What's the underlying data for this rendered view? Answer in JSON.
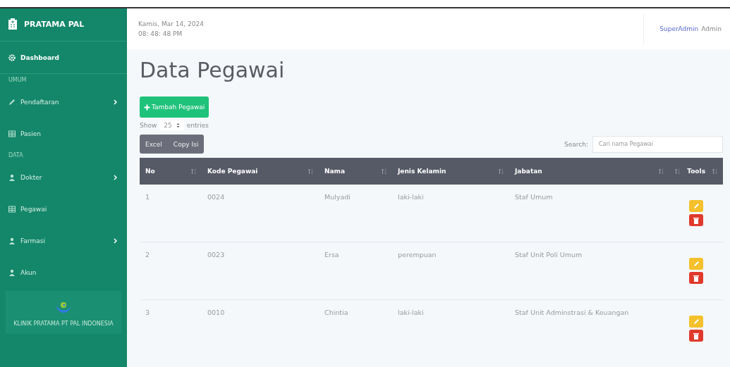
{
  "brand": {
    "title": "PRATAMA PAL"
  },
  "sidebar": {
    "items": [
      {
        "kind": "link",
        "label": "Dashboard",
        "chevron": false,
        "selected": true
      },
      {
        "kind": "heading",
        "label": "UMUM"
      },
      {
        "kind": "link",
        "label": "Pendaftaran",
        "chevron": true,
        "selected": false
      },
      {
        "kind": "link",
        "label": "Pasien",
        "chevron": false,
        "selected": false
      },
      {
        "kind": "heading",
        "label": "DATA"
      },
      {
        "kind": "link",
        "label": "Dokter",
        "chevron": true,
        "selected": false
      },
      {
        "kind": "link",
        "label": "Pegawai",
        "chevron": false,
        "selected": false
      },
      {
        "kind": "link",
        "label": "Farmasi",
        "chevron": true,
        "selected": false
      },
      {
        "kind": "link",
        "label": "Akun",
        "chevron": false,
        "selected": false
      }
    ],
    "footer": {
      "text": "KLINIK PRATAMA PT PAL INDONESIA"
    }
  },
  "topbar": {
    "date": "Kamis, Mar 14, 2024",
    "time": "08: 48: 48 PM",
    "user": "SuperAdmin",
    "role": "Admin"
  },
  "page": {
    "title": "Data Pegawai",
    "add_button": "Tambah Pegawai",
    "show_label": "Show",
    "entries_value": "25",
    "entries_label": "entries",
    "export_buttons": [
      "Excel",
      "Copy Isi"
    ],
    "search_label": "Search:",
    "search_placeholder": "Cari nama Pegawai"
  },
  "table": {
    "columns": [
      "No",
      "Kode Pegawai",
      "Nama",
      "Jenis Kelamin",
      "Jabatan",
      "Tools"
    ],
    "rows": [
      {
        "no": "1",
        "kode": "0024",
        "nama": "Mulyadi",
        "jenis_kelamin": "laki-laki",
        "jabatan": "Staf Umum"
      },
      {
        "no": "2",
        "kode": "0023",
        "nama": "Ersa",
        "jenis_kelamin": "perempuan",
        "jabatan": "Staf Unit Poli Umum"
      },
      {
        "no": "3",
        "kode": "0010",
        "nama": "Chintia",
        "jenis_kelamin": "laki-laki",
        "jabatan": "Staf Unit Adminstrasi & Keuangan"
      }
    ]
  }
}
